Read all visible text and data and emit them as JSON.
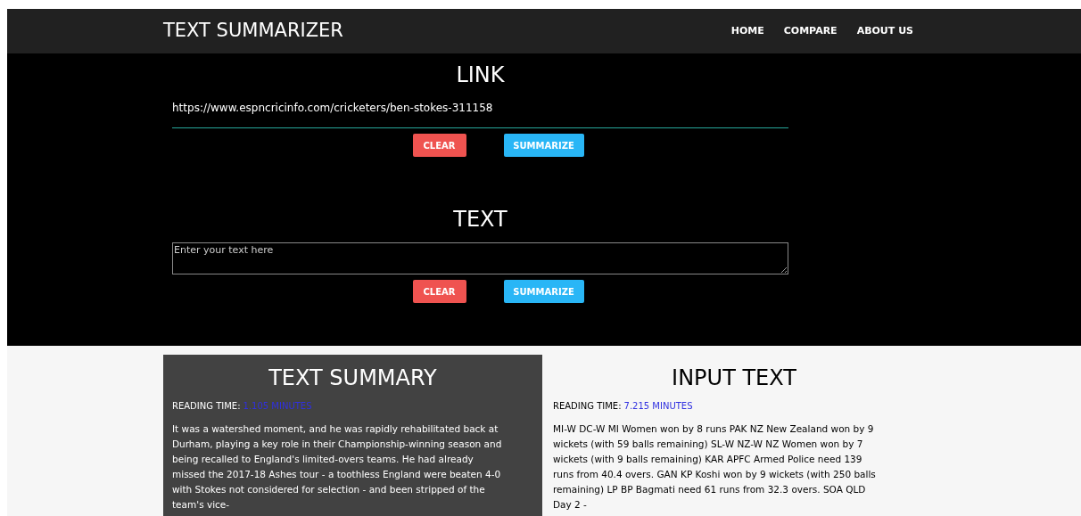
{
  "navbar": {
    "title": "TEXT SUMMARIZER",
    "links": [
      "HOME",
      "COMPARE",
      "ABOUT US"
    ]
  },
  "link_section": {
    "heading": "LINK",
    "value": "https://www.espncricinfo.com/cricketers/ben-stokes-311158",
    "buttons": [
      {
        "kind": "clear",
        "label": "CLEAR"
      },
      {
        "kind": "summarize",
        "label": "SUMMARIZE"
      }
    ]
  },
  "text_section": {
    "heading": "TEXT",
    "placeholder": "Enter your text here",
    "buttons": [
      {
        "kind": "clear",
        "label": "CLEAR"
      },
      {
        "kind": "summarize",
        "label": "SUMMARIZE"
      }
    ]
  },
  "summary": {
    "heading": "TEXT SUMMARY",
    "reading_label": "READING TIME:",
    "reading_value": "1.105 MINUTES",
    "body": "It was a watershed moment, and he was rapidly rehabilitated back at Durham, playing a key role in their Championship-winning season and being recalled to England's limited-overs teams. He had already missed the 2017-18 Ashes tour - a toothless England were beaten 4-0 with Stokes not considered for selection - and been stripped of the team's vice-"
  },
  "input_text": {
    "heading": "INPUT TEXT",
    "reading_label": "READING TIME:",
    "reading_value": "7.215 MINUTES",
    "body": "MI-W DC-W MI Women won by 8 runs PAK NZ New Zealand won by 9 wickets (with 59 balls remaining) SL-W NZ-W NZ Women won by 7 wickets (with 9 balls remaining) KAR APFC Armed Police need 139 runs from 40.4 overs. GAN KP Koshi won by 9 wickets (with 250 balls remaining) LP BP Bagmati need 61 runs from 32.3 overs. SOA QLD Day 2 -"
  }
}
